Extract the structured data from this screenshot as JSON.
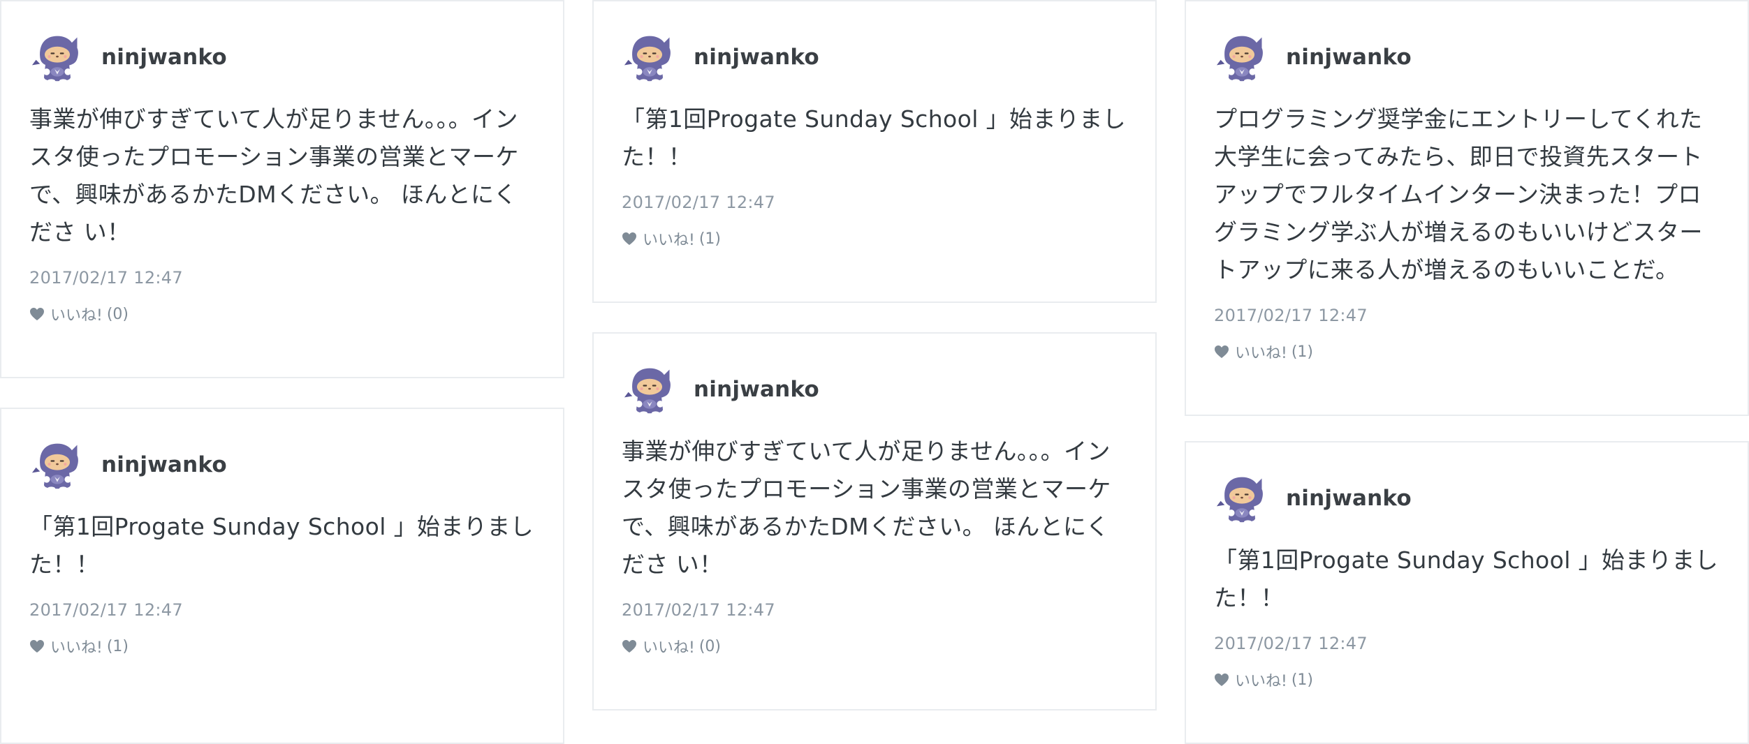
{
  "colors": {
    "border": "#e9ecef",
    "username": "#3a3f44",
    "text": "#333a40",
    "muted": "#8d98a3",
    "avatar_body": "#6b68a6",
    "heart": "#7f8b96"
  },
  "posts": [
    {
      "username": "ninjwanko",
      "text": "事業が伸びすぎていて人が足りません。。。インスタ使ったプロモーション事業の営業とマーケで、興味があるかたDMください。 ほんとにくださ い！",
      "timestamp": "2017/02/17 12:47",
      "like_label": "いいね!",
      "like_count": "(0)",
      "avatar_icon": "ninja-dog-avatar-icon",
      "like_icon": "heart-icon"
    },
    {
      "username": "ninjwanko",
      "text": "「第1回Progate Sunday School 」始まりました！！",
      "timestamp": "2017/02/17 12:47",
      "like_label": "いいね!",
      "like_count": "(1)",
      "avatar_icon": "ninja-dog-avatar-icon",
      "like_icon": "heart-icon"
    },
    {
      "username": "ninjwanko",
      "text": "プログラミング奨学金にエントリーしてくれた大学生に会ってみたら、即日で投資先スタートアップでフルタイムインターン決まった！プログラミング学ぶ人が増えるのもいいけどスタートアップに来る人が増えるのもいいことだ。",
      "timestamp": "2017/02/17 12:47",
      "like_label": "いいね!",
      "like_count": "(1)",
      "avatar_icon": "ninja-dog-avatar-icon",
      "like_icon": "heart-icon"
    },
    {
      "username": "ninjwanko",
      "text": "「第1回Progate Sunday School 」始まりました！！",
      "timestamp": "2017/02/17 12:47",
      "like_label": "いいね!",
      "like_count": "(1)",
      "avatar_icon": "ninja-dog-avatar-icon",
      "like_icon": "heart-icon"
    },
    {
      "username": "ninjwanko",
      "text": "事業が伸びすぎていて人が足りません。。。インスタ使ったプロモーション事業の営業とマーケで、興味があるかたDMください。 ほんとにくださ い！",
      "timestamp": "2017/02/17 12:47",
      "like_label": "いいね!",
      "like_count": "(0)",
      "avatar_icon": "ninja-dog-avatar-icon",
      "like_icon": "heart-icon"
    },
    {
      "username": "ninjwanko",
      "text": "「第1回Progate Sunday School 」始まりました！！",
      "timestamp": "2017/02/17 12:47",
      "like_label": "いいね!",
      "like_count": "(1)",
      "avatar_icon": "ninja-dog-avatar-icon",
      "like_icon": "heart-icon"
    }
  ]
}
